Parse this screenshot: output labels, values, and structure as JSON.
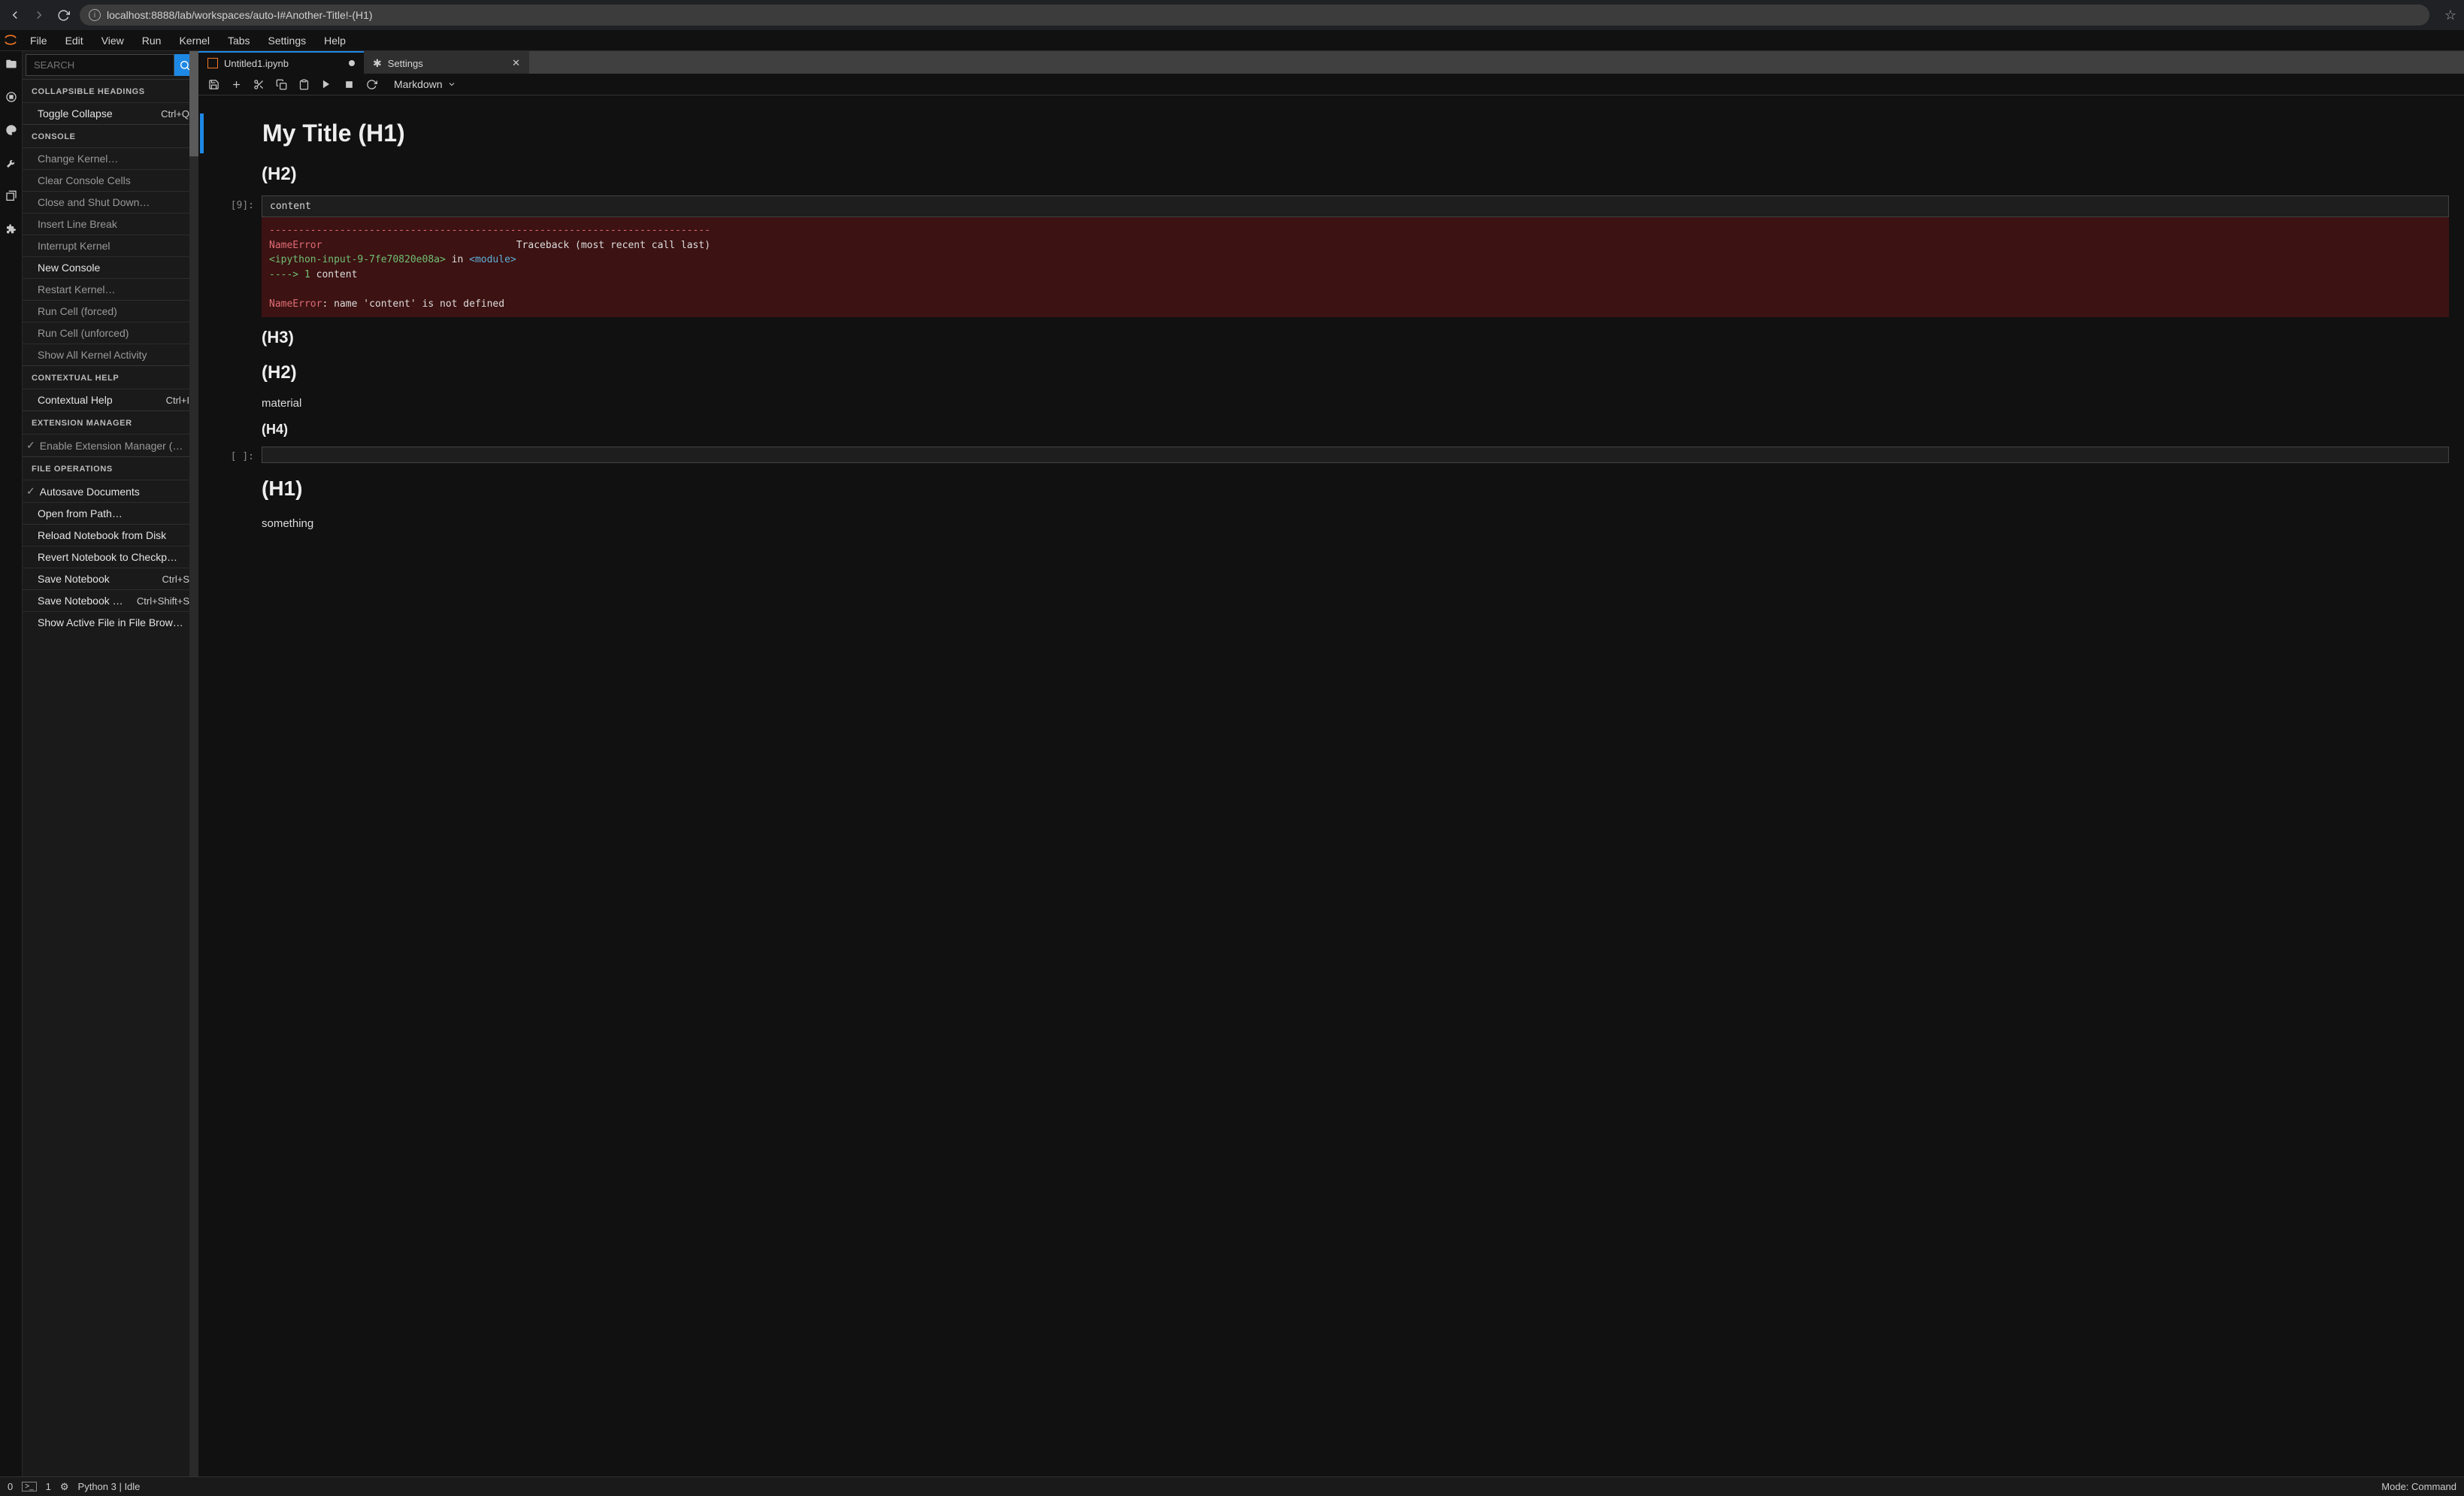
{
  "browser": {
    "url": "localhost:8888/lab/workspaces/auto-I#Another-Title!-(H1)"
  },
  "menu": {
    "file": "File",
    "edit": "Edit",
    "view": "View",
    "run": "Run",
    "kernel": "Kernel",
    "tabs": "Tabs",
    "settings": "Settings",
    "help": "Help"
  },
  "sidebar": {
    "search_placeholder": "SEARCH",
    "sections": {
      "coll_head": "COLLAPSIBLE HEADINGS",
      "console": "CONSOLE",
      "ctx_help": "CONTEXTUAL HELP",
      "ext_mgr": "EXTENSION MANAGER",
      "file_ops": "FILE OPERATIONS"
    },
    "items": {
      "toggle_collapse": "Toggle Collapse",
      "toggle_collapse_sc": "Ctrl+Q",
      "change_kernel": "Change Kernel…",
      "clear_console": "Clear Console Cells",
      "close_shut": "Close and Shut Down…",
      "insert_lb": "Insert Line Break",
      "interrupt_k": "Interrupt Kernel",
      "new_console": "New Console",
      "restart_k": "Restart Kernel…",
      "run_forced": "Run Cell (forced)",
      "run_unforced": "Run Cell (unforced)",
      "show_kernel_act": "Show All Kernel Activity",
      "ctx_help_item": "Contextual Help",
      "ctx_help_sc": "Ctrl+I",
      "enable_ext": "Enable Extension Manager (…",
      "autosave": "Autosave Documents",
      "open_path": "Open from Path…",
      "reload_nb": "Reload Notebook from Disk",
      "revert_nb": "Revert Notebook to Checkp…",
      "save_nb": "Save Notebook",
      "save_nb_sc": "Ctrl+S",
      "save_nb_as": "Save Notebook …",
      "save_nb_as_sc": "Ctrl+Shift+S",
      "show_active_file": "Show Active File in File Brow…"
    }
  },
  "tabs": {
    "untitled": "Untitled1.ipynb",
    "settings": "Settings"
  },
  "toolbar": {
    "celltype": "Markdown"
  },
  "cells": {
    "h1_title": "My Title (H1)",
    "h2_1": "(H2)",
    "prompt_9": "[9]:",
    "code_9": "content",
    "err_dash": "---------------------------------------------------------------------------",
    "err_name": "NameError",
    "err_traceback": "Traceback (most recent call last)",
    "err_loc": "<ipython-input-9-7fe70820e08a>",
    "err_in": " in ",
    "err_module": "<module>",
    "err_arrow": "----> 1",
    "err_arrow_tail": " content",
    "err_final_name": "NameError",
    "err_final_msg": ": name 'content' is not defined",
    "h3": "(H3)",
    "h2_2": "(H2)",
    "material": "material",
    "h4": "(H4)",
    "prompt_empty": "[ ]:",
    "h1_2": "(H1)",
    "something": "something"
  },
  "status": {
    "zero": "0",
    "one": "1",
    "kernel": "Python 3 | Idle",
    "mode": "Mode: Command"
  }
}
